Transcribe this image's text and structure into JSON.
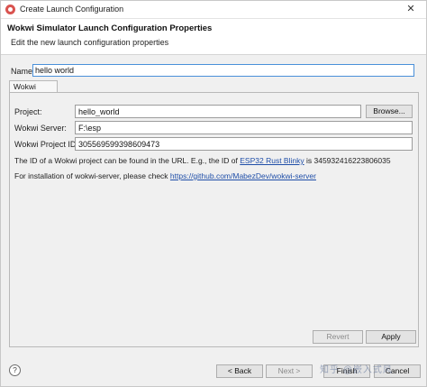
{
  "window": {
    "title": "Create Launch Configuration",
    "close_glyph": "✕"
  },
  "header": {
    "title": "Wokwi Simulator Launch Configuration Properties",
    "subtitle": "Edit the new launch configuration properties"
  },
  "name": {
    "label": "Name:",
    "value": "hello world"
  },
  "tab": {
    "label": "Wokwi Server"
  },
  "fields": {
    "project_label": "Project:",
    "project_value": "hello_world",
    "browse_label": "Browse...",
    "server_label": "Wokwi Server:",
    "server_value": "F:\\esp",
    "project_id_label": "Wokwi Project ID:",
    "project_id_value": "305569599398609473"
  },
  "info": {
    "line1_pre": "The ID of a Wokwi project can be found in the URL. E.g., the ID of",
    "line1_link": "ESP32 Rust Blinky",
    "line1_post": "is 345932416223806035",
    "line2_pre": "For installation of wokwi-server, please check",
    "line2_link": "https://github.com/MabezDev/wokwi-server"
  },
  "actions": {
    "revert": "Revert",
    "apply": "Apply"
  },
  "footer": {
    "help_glyph": "?",
    "back": "< Back",
    "next": "Next >",
    "finish": "Finish",
    "cancel": "Cancel",
    "watermark": "知乎 @嵌入式风"
  },
  "icons": {
    "app": "eclipse-icon",
    "help": "help-icon",
    "close": "close-icon"
  },
  "colors": {
    "focus_border": "#4a90d9",
    "link": "#1f4ea8",
    "app_icon": "#d9534f"
  }
}
